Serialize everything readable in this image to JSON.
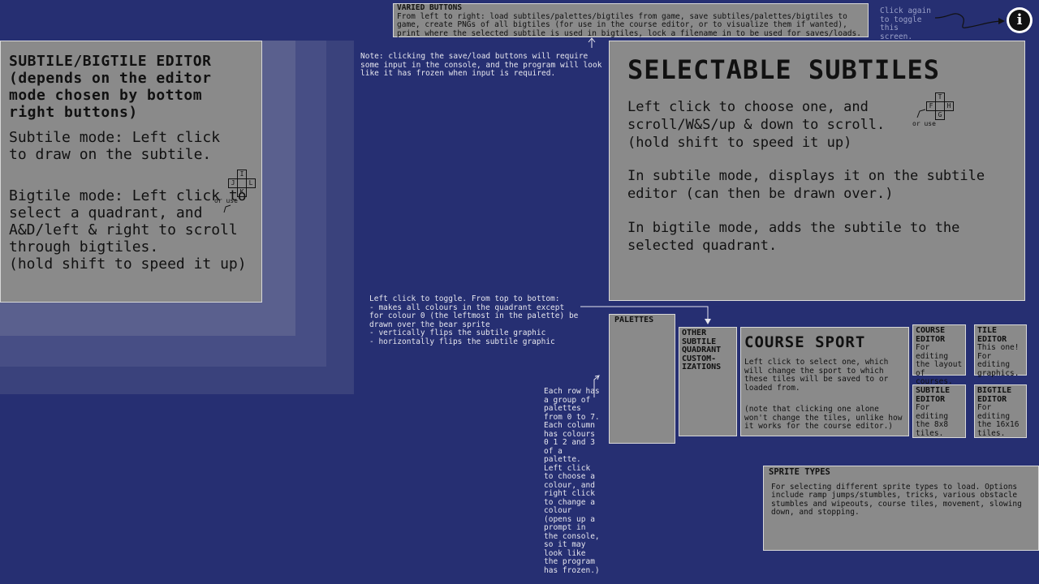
{
  "varied_buttons": {
    "title": "VARIED BUTTONS",
    "text": "From left to right: load subtiles/palettes/bigtiles from game, save subtiles/palettes/bigtiles to game, create PNGs of all bigtiles (for use in the course editor, or to visualize them if wanted), print where the selected subtile is used in bigtiles, lock a filename in to be used for saves/loads."
  },
  "info_hint": {
    "text": "Click again to toggle this screen.",
    "icon": "info-icon"
  },
  "save_note": "Note: clicking the save/load buttons will require some input in the console, and the program will look like it has frozen when input is required.",
  "editor_panel": {
    "title": "SUBTILE/BIGTILE EDITOR (depends on the editor mode chosen by bottom right buttons)",
    "subtile_mode": "Subtile mode: Left click to draw on the subtile.",
    "or_use": "or use",
    "keys": [
      "I",
      "J",
      "L",
      "K"
    ],
    "bigtile_mode": "Bigtile mode: Left click to select a quadrant, and A&D/left & right to scroll through bigtiles.",
    "shift_hint": "(hold shift to speed it up)"
  },
  "selectable_panel": {
    "title": "SELECTABLE SUBTILES",
    "line1": "Left click to choose one, and scroll/W&S/up & down to scroll.",
    "shift_hint": "(hold shift to speed it up)",
    "or_use": "or use",
    "keys": [
      "T",
      "F",
      "H",
      "G"
    ],
    "subtile_mode": "In subtile mode, displays it on the subtile editor (can then be drawn over.)",
    "bigtile_mode": "In bigtile mode, adds the subtile to the selected quadrant."
  },
  "toggle_note": "Left click to toggle. From top to bottom:\n- makes all colours in the quadrant except for colour 0 (the leftmost in the palette) be drawn over the bear sprite\n- vertically flips the subtile graphic\n- horizontally flips the subtile graphic",
  "palette_note": "Each row has a group of palettes from 0 to 7. Each column has colours 0 1 2 and 3 of a palette. Left click to choose a colour, and right click to change a colour (opens up a prompt in the console, so it may look like the program has frozen.)",
  "palettes": {
    "title": "PALETTES"
  },
  "quadrant": {
    "title": "OTHER SUBTILE QUADRANT CUSTOM- IZATIONS"
  },
  "course_sport": {
    "title": "COURSE SPORT",
    "text": "Left click to select one, which will change the sport to which these tiles will be saved to or loaded from.",
    "note": "(note that clicking one alone won't change the tiles, unlike how it works for the course editor.)"
  },
  "course_editor": {
    "title": "COURSE EDITOR",
    "text": "For editing the layout of courses."
  },
  "tile_editor": {
    "title": "TILE EDITOR",
    "text": "This one! For editing graphics."
  },
  "subtile_editor": {
    "title": "SUBTILE EDITOR",
    "text": "For editing the 8x8 tiles."
  },
  "bigtile_editor": {
    "title": "BIGTILE EDITOR",
    "text": "For editing the 16x16 tiles."
  },
  "sprite_types": {
    "title": "SPRITE TYPES",
    "text": "For selecting different sprite types to load. Options include ramp jumps/stumbles, tricks, various obstacle stumbles and wipeouts, course tiles, movement, slowing down, and stopping."
  }
}
